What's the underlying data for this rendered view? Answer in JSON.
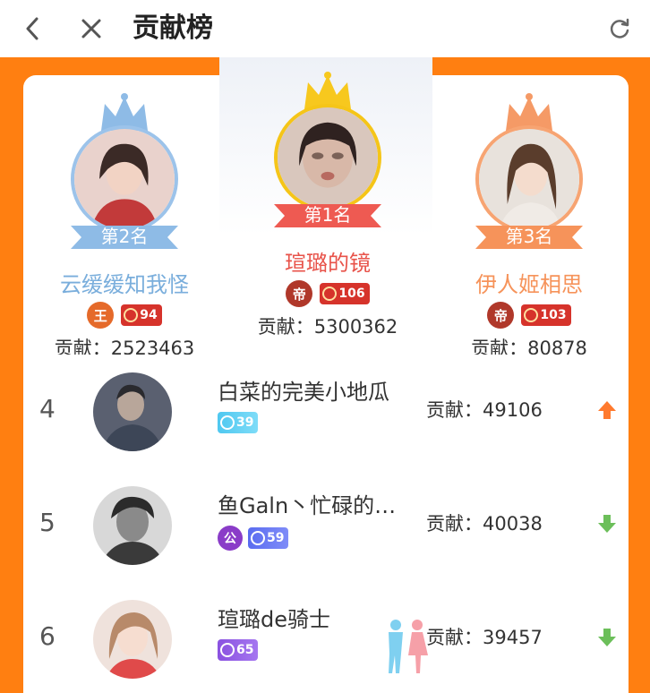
{
  "header": {
    "title": "贡献榜",
    "back_icon": "chevron-left-icon",
    "close_icon": "close-icon",
    "refresh_icon": "refresh-icon"
  },
  "colors": {
    "accent_orange": "#ff7f11",
    "second_blue": "#7aaedc",
    "first_red": "#e8534a",
    "third_orange": "#f6935a",
    "trend_up": "#ff7a2e",
    "trend_down": "#6cbf5a"
  },
  "top3": [
    {
      "rank_label": "第2名",
      "name": "云缓缓知我怪",
      "rank_badge": "王",
      "level": "94",
      "contribution": "贡献：2523463"
    },
    {
      "rank_label": "第1名",
      "name": "瑄璐的镜",
      "rank_badge": "帝",
      "level": "106",
      "contribution": "贡献：5300362"
    },
    {
      "rank_label": "第3名",
      "name": "伊人姬相思",
      "rank_badge": "帝",
      "level": "103",
      "contribution": "贡献：80878"
    }
  ],
  "list": [
    {
      "rank": "4",
      "name": "白菜的完美小地瓜",
      "level": "39",
      "contribution": "贡献：49106",
      "trend": "up",
      "trend_icon": "arrow-up-icon"
    },
    {
      "rank": "5",
      "name": "鱼Galn丶忙碌的…",
      "fan_badge": "公",
      "level": "59",
      "contribution": "贡献：40038",
      "trend": "down",
      "trend_icon": "arrow-down-icon"
    },
    {
      "rank": "6",
      "name": "瑄璐de骑士",
      "level": "65",
      "contribution": "贡献：39457",
      "trend": "down",
      "trend_icon": "arrow-down-icon",
      "extra_icon": "couple-icon"
    }
  ]
}
